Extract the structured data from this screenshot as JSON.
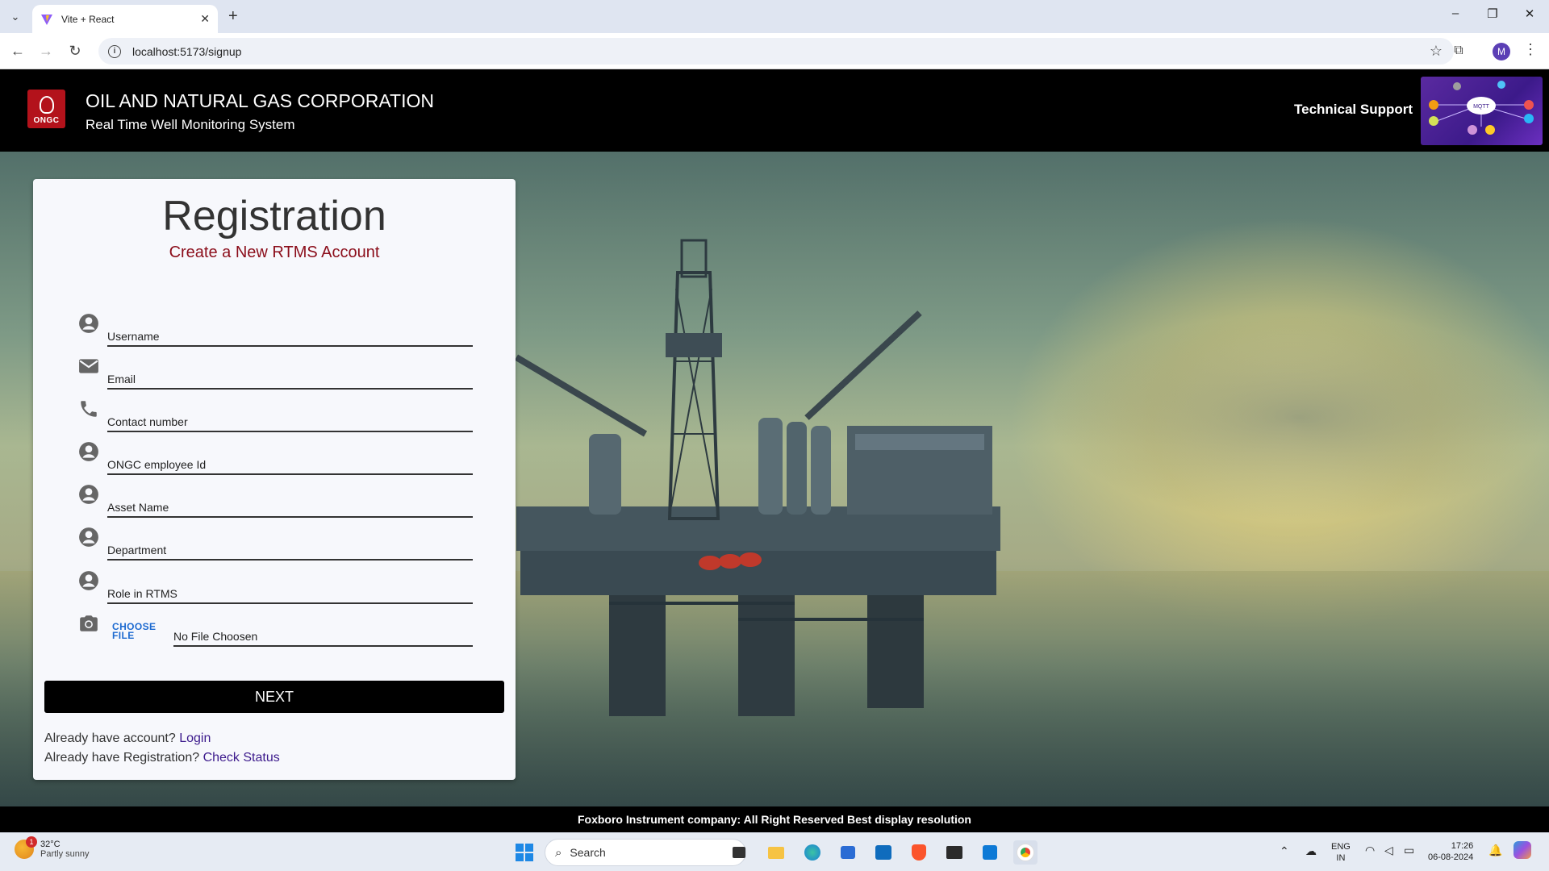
{
  "browser": {
    "tab_title": "Vite + React",
    "url": "localhost:5173/signup",
    "profile_initial": "M"
  },
  "header": {
    "org_title": "OIL AND NATURAL GAS CORPORATION",
    "org_subtitle": "Real Time Well Monitoring System",
    "logo_text": "ONGC",
    "support_label": "Technical Support",
    "support_image_text": "MQTT"
  },
  "form": {
    "title": "Registration",
    "subtitle": "Create a New RTMS Account",
    "fields": [
      {
        "label": "Username",
        "icon": "account-circle-icon"
      },
      {
        "label": "Email",
        "icon": "email-icon"
      },
      {
        "label": "Contact number",
        "icon": "phone-icon"
      },
      {
        "label": "ONGC employee Id",
        "icon": "account-circle-icon"
      },
      {
        "label": "Asset Name",
        "icon": "account-circle-icon"
      },
      {
        "label": "Department",
        "icon": "account-circle-icon"
      },
      {
        "label": "Role in RTMS",
        "icon": "account-circle-icon"
      }
    ],
    "file": {
      "button_label": "CHOOSE FILE",
      "status": "No File Choosen",
      "icon": "camera-icon"
    },
    "next_label": "NEXT",
    "login_prompt": "Already have account?",
    "login_link": "Login",
    "status_prompt": "Already have Registration?",
    "status_link": "Check Status"
  },
  "footer": {
    "text": "Foxboro Instrument company: All Right Reserved Best display resolution"
  },
  "taskbar": {
    "weather_temp": "32°C",
    "weather_desc": "Partly sunny",
    "weather_badge": "1",
    "search_label": "Search",
    "language": "ENG",
    "region": "IN",
    "time": "17:26",
    "date": "06-08-2024"
  },
  "colors": {
    "accent_title": "#8b0d1a",
    "link": "#3c1a8c",
    "file_button": "#1d6ad0",
    "ongc_red": "#b3121b"
  }
}
